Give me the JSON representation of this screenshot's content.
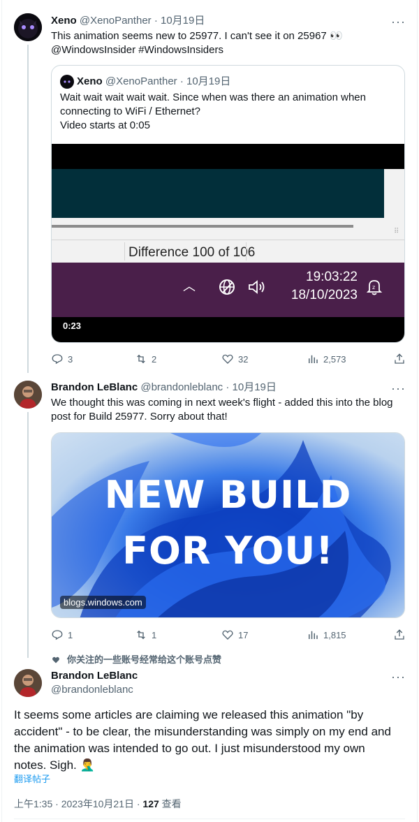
{
  "tweet1": {
    "name": "Xeno",
    "handle": "@XenoPanther",
    "date": "10月19日",
    "text": "This animation seems new to 25977. I can't see it on 25967",
    "emoji": "👀",
    "hashtags": "@WindowsInsider #WindowsInsiders",
    "more_glyph": "···",
    "quote": {
      "name": "Xeno",
      "handle": "@XenoPanther",
      "date": "10月19日",
      "line1": "Wait wait wait wait wait. Since when was there an animation when",
      "line2": "connecting to WiFi / Ethernet?",
      "line3": "Video starts at 0:05",
      "video": {
        "difference_text": "Difference 100 of 106",
        "time": "19:03:22",
        "date": "18/10/2023",
        "timestamp": "0:23"
      }
    },
    "actions": {
      "replies": "3",
      "retweets": "2",
      "likes": "32",
      "views": "2,573"
    }
  },
  "tweet2": {
    "name": "Brandon LeBlanc",
    "handle": "@brandonleblanc",
    "date": "10月19日",
    "line1": "We thought this was coming in next week's flight - added this into the blog",
    "line2": "post for Build 25977. Sorry about that!",
    "more_glyph": "···",
    "card": {
      "headline1": "NEW BUILD",
      "headline2": "FOR YOU!",
      "source": "blogs.windows.com"
    },
    "actions": {
      "replies": "1",
      "retweets": "1",
      "likes": "17",
      "views": "1,815"
    }
  },
  "social_context": "你关注的一些账号经常给这个账号点赞",
  "main_tweet": {
    "name": "Brandon LeBlanc",
    "handle": "@brandonleblanc",
    "more_glyph": "···",
    "line1": "It seems some articles are claiming we released this animation \"by",
    "line2": "accident\" - to be clear, the misunderstanding was simply on my end and",
    "line3": "the animation was intended to go out. I just misunderstood my own",
    "line4": "notes. Sigh.",
    "emoji": "🤦‍♂️",
    "translate": "翻译帖子",
    "timestamp": "上午1:35 · 2023年10月21日 · ",
    "views_count": "127",
    "views_label": " 查看"
  },
  "colors": {
    "accent": "#1d9bf0",
    "muted": "#536471",
    "taskbar": "#4a1f4a",
    "video_teal": "#022f3a"
  }
}
